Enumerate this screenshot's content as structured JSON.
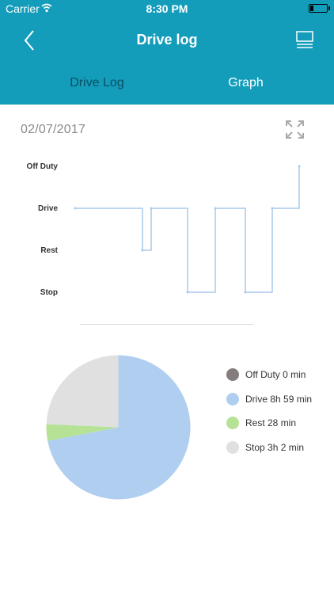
{
  "status": {
    "carrier": "Carrier",
    "time": "8:30 PM",
    "battery_level": 0.2
  },
  "nav": {
    "title": "Drive log",
    "back_icon": "chevron-left-icon",
    "menu_icon": "list-icon"
  },
  "tabs": [
    {
      "label": "Drive Log",
      "selected": false
    },
    {
      "label": "Graph",
      "selected": true
    }
  ],
  "date": "02/07/2017",
  "colors": {
    "header": "#139dbb",
    "off_duty": "#837d7d",
    "drive": "#b0cff0",
    "rest": "#b6e296",
    "stop": "#e0e0e0",
    "line": "#a9c9ec"
  },
  "chart_data": [
    {
      "type": "line",
      "title": "",
      "y_categories": [
        "Off Duty",
        "Drive",
        "Rest",
        "Stop"
      ],
      "steps": [
        "Drive",
        "Rest",
        "Drive",
        "Stop",
        "Drive",
        "Stop",
        "Drive",
        "Off Duty"
      ],
      "note": "step chart of duty status through the day"
    },
    {
      "type": "pie",
      "slices": [
        {
          "name": "Off Duty",
          "minutes": 0,
          "label": "Off Duty 0 min"
        },
        {
          "name": "Drive",
          "minutes": 539,
          "label": "Drive 8h 59 min"
        },
        {
          "name": "Rest",
          "minutes": 28,
          "label": "Rest 28 min"
        },
        {
          "name": "Stop",
          "minutes": 182,
          "label": "Stop 3h 2 min"
        }
      ]
    }
  ]
}
